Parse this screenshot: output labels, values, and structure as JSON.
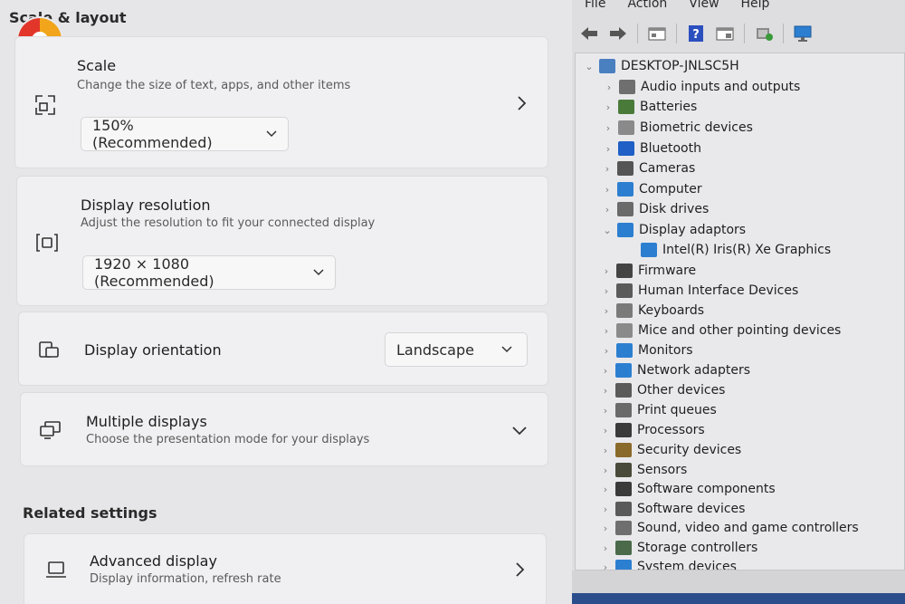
{
  "settings": {
    "section_title": "Scale & layout",
    "scale": {
      "title": "Scale",
      "subtitle": "Change the size of text, apps, and other items",
      "value": "150% (Recommended)"
    },
    "resolution": {
      "title": "Display resolution",
      "subtitle": "Adjust the resolution to fit your connected display",
      "value": "1920 × 1080 (Recommended)"
    },
    "orientation": {
      "title": "Display orientation",
      "value": "Landscape"
    },
    "multiple": {
      "title": "Multiple displays",
      "subtitle": "Choose the presentation mode for your displays"
    },
    "related_title": "Related settings",
    "advanced": {
      "title": "Advanced display",
      "subtitle": "Display information, refresh rate"
    }
  },
  "device_manager": {
    "menu": [
      "File",
      "Action",
      "View",
      "Help"
    ],
    "computer_name": "DESKTOP-JNLSC5H",
    "nodes": [
      {
        "label": "Audio inputs and outputs",
        "icon": "speaker-icon",
        "color": "#6f6f6f"
      },
      {
        "label": "Batteries",
        "icon": "battery-icon",
        "color": "#4a7a3a"
      },
      {
        "label": "Biometric devices",
        "icon": "fingerprint-icon",
        "color": "#8a8a8a"
      },
      {
        "label": "Bluetooth",
        "icon": "bluetooth-icon",
        "color": "#1f5fc6"
      },
      {
        "label": "Cameras",
        "icon": "camera-icon",
        "color": "#555555"
      },
      {
        "label": "Computer",
        "icon": "monitor-icon",
        "color": "#2c7fd0"
      },
      {
        "label": "Disk drives",
        "icon": "disk-icon",
        "color": "#6a6a6a"
      },
      {
        "label": "Display adaptors",
        "icon": "display-adapter-icon",
        "color": "#2c7fd0"
      },
      {
        "label": "Firmware",
        "icon": "chip-icon",
        "color": "#444444"
      },
      {
        "label": "Human Interface Devices",
        "icon": "hid-icon",
        "color": "#5a5a5a"
      },
      {
        "label": "Keyboards",
        "icon": "keyboard-icon",
        "color": "#7a7a7a"
      },
      {
        "label": "Mice and other pointing devices",
        "icon": "mouse-icon",
        "color": "#8a8a8a"
      },
      {
        "label": "Monitors",
        "icon": "monitor-icon",
        "color": "#2c7fd0"
      },
      {
        "label": "Network adapters",
        "icon": "network-icon",
        "color": "#2c7fd0"
      },
      {
        "label": "Other devices",
        "icon": "unknown-device-icon",
        "color": "#5a5a5a"
      },
      {
        "label": "Print queues",
        "icon": "printer-icon",
        "color": "#6a6a6a"
      },
      {
        "label": "Processors",
        "icon": "cpu-icon",
        "color": "#3a3a3a"
      },
      {
        "label": "Security devices",
        "icon": "security-icon",
        "color": "#8a6a2a"
      },
      {
        "label": "Sensors",
        "icon": "sensor-icon",
        "color": "#4a4a3a"
      },
      {
        "label": "Software components",
        "icon": "component-icon",
        "color": "#3a3a3a"
      },
      {
        "label": "Software devices",
        "icon": "software-device-icon",
        "color": "#5a5a5a"
      },
      {
        "label": "Sound, video and game controllers",
        "icon": "speaker-icon",
        "color": "#6f6f6f"
      },
      {
        "label": "Storage controllers",
        "icon": "storage-icon",
        "color": "#4a6a4a"
      },
      {
        "label": "System devices",
        "icon": "system-icon",
        "color": "#2c7fd0"
      }
    ],
    "child": {
      "label": "Intel(R) Iris(R) Xe Graphics",
      "icon": "display-adapter-icon",
      "color": "#2c7fd0"
    }
  }
}
